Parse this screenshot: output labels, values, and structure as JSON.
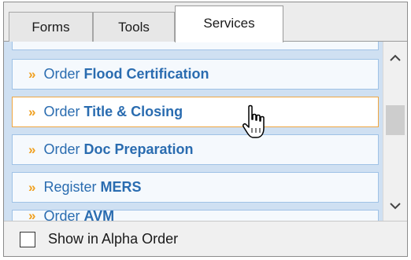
{
  "tabs": [
    {
      "label": "Forms",
      "active": false
    },
    {
      "label": "Tools",
      "active": false
    },
    {
      "label": "Services",
      "active": true
    }
  ],
  "services": {
    "items": [
      {
        "prefix": "Order",
        "name": "Flood Certification"
      },
      {
        "prefix": "Order",
        "name": "Title & Closing",
        "hovered": true
      },
      {
        "prefix": "Order",
        "name": "Doc Preparation"
      },
      {
        "prefix": "Register",
        "name": "MERS"
      },
      {
        "prefix": "Order",
        "name": "AVM"
      }
    ],
    "chevron": "»"
  },
  "footer": {
    "checkbox_label": "Show in Alpha Order",
    "checked": false
  },
  "icons": {
    "scroll_up": "chevron-up-icon",
    "scroll_down": "chevron-down-icon",
    "cursor": "hand-pointer-icon"
  },
  "colors": {
    "item_text": "#2a6cb0",
    "chevron": "#f0a020",
    "hover_border": "#f0a640",
    "item_border": "#9fc2e6",
    "list_bg": "#cfe0f2"
  }
}
